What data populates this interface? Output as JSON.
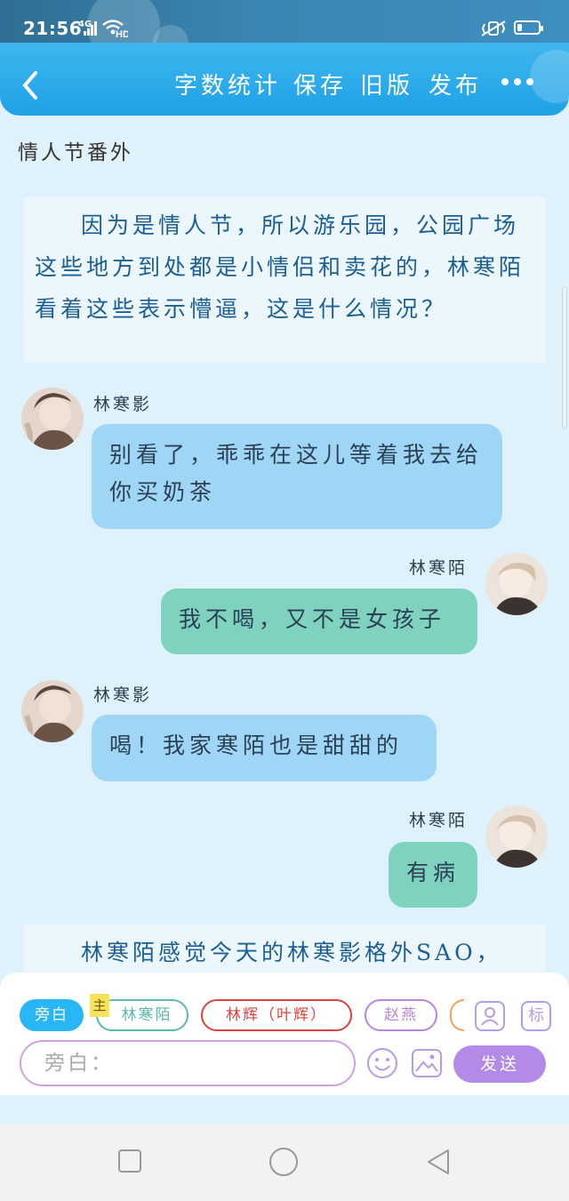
{
  "status": {
    "time": "21:56",
    "network": "4G",
    "hd": "HD"
  },
  "toolbar": {
    "word_count": "字数统计",
    "save": "保存",
    "old_version": "旧版",
    "publish": "发布",
    "back_icon": "back-chevron-icon",
    "more_icon": "more-dots-icon"
  },
  "chapter": {
    "title": "情人节番外"
  },
  "conversation": {
    "narration_1": "因为是情人节，所以游乐园，公园广场这些地方到处都是小情侣和卖花的，林寒陌看着这些表示懵逼，这是什么情况？",
    "messages": [
      {
        "speaker": "林寒影",
        "text": "别看了，乖乖在这儿等着我去给你买奶茶",
        "side": "left"
      },
      {
        "speaker": "林寒陌",
        "text": "我不喝，又不是女孩子",
        "side": "right"
      },
      {
        "speaker": "林寒影",
        "text": "喝！我家寒陌也是甜甜的",
        "side": "left"
      },
      {
        "speaker": "林寒陌",
        "text": "有病",
        "side": "right"
      }
    ],
    "narration_2": "林寒陌感觉今天的林寒影格外SAO，"
  },
  "composer": {
    "roles": [
      "旁白",
      "林寒陌",
      "林辉（叶辉）",
      "赵燕"
    ],
    "main_badge": "主",
    "input_placeholder": "旁白：",
    "send_label": "发送",
    "mark_label": "标",
    "colors": {
      "narrator_chip": "#29b6f6",
      "role1": "#5bb8b0",
      "role2": "#e0413e",
      "role3": "#b685e0",
      "send": "#b48ae8"
    }
  }
}
